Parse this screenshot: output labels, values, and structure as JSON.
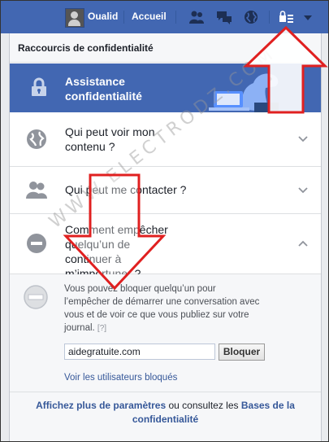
{
  "topbar": {
    "user_name": "Oualid",
    "home_label": "Accueil",
    "icons": [
      "friends-icon",
      "messages-icon",
      "globe-icon",
      "privacy-lock-icon",
      "caret-down-icon"
    ]
  },
  "panel": {
    "title": "Raccourcis de confidentialité",
    "assistance": {
      "label": "Assistance confidentialité",
      "icon": "lock-icon"
    },
    "rows": [
      {
        "label": "Qui peut voir mon contenu ?",
        "icon": "globe-icon"
      },
      {
        "label": "Qui peut me contacter ?",
        "icon": "people-icon"
      },
      {
        "label": "Comment empêcher quelqu’un de continuer à m’importuner ?",
        "icon": "block-icon"
      }
    ],
    "expanded": {
      "description": "Vous pouvez bloquer quelqu’un pour l’empêcher de démarrer une conversation avec vous et de voir ce que vous publiez sur votre journal.",
      "help": "[?]",
      "input_value": "aidegratuite.com",
      "block_button": "Bloquer",
      "blocked_link": "Voir les utilisateurs bloqués"
    },
    "footer": {
      "link1": "Affichez plus de paramètres",
      "middle": " ou consultez les ",
      "link2": "Bases de la confidentialité"
    }
  },
  "watermark": "WWW.ELECTRODZ.COM",
  "colors": {
    "brand": "#4267b2",
    "link": "#365899",
    "arrow": "#e02020"
  }
}
